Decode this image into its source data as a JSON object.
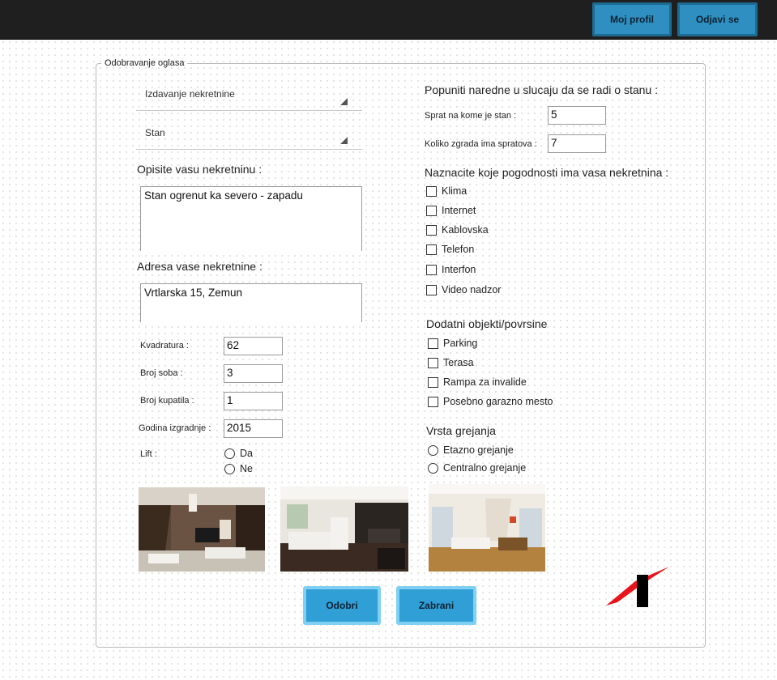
{
  "header": {
    "profile_label": "Moj profil",
    "logout_label": "Odjavi se"
  },
  "form": {
    "legend": "Odobravanje oglasa",
    "type_select": "Izdavanje nekretnine",
    "kind_select": "Stan",
    "description_label": "Opisite vasu nekretninu :",
    "description_value": "Stan ogrenut ka severo - zapadu",
    "address_label": "Adresa vase nekretnine :",
    "address_value": "Vrtlarska 15, Zemun",
    "fields": [
      {
        "label": "Kvadratura :",
        "value": "62"
      },
      {
        "label": "Broj soba :",
        "value": "3"
      },
      {
        "label": "Broj kupatila :",
        "value": "1"
      },
      {
        "label": "Godina izgradnje :",
        "value": "2015"
      }
    ],
    "lift": {
      "label": "Lift :",
      "options": [
        "Da",
        "Ne"
      ]
    },
    "apartment_title": "Popuniti naredne u slucaju da se radi o stanu :",
    "floor_label": "Sprat na kome je stan :",
    "floor_value": "5",
    "floors_total_label": "Koliko zgrada ima spratova :",
    "floors_total_value": "7",
    "amenities_title": "Naznacite koje pogodnosti ima vasa nekretnina :",
    "amenities": [
      "Klima",
      "Internet",
      "Kablovska",
      "Telefon",
      "Interfon",
      "Video nadzor"
    ],
    "extras_title": "Dodatni objekti/povrsine",
    "extras": [
      "Parking",
      "Terasa",
      "Rampa za invalide",
      "Posebno garazno mesto"
    ],
    "heating_title": "Vrsta grejanja",
    "heating": [
      "Etazno grejanje",
      "Centralno grejanje"
    ],
    "photos": [
      "living-room-photo",
      "lounge-kitchen-photo",
      "dining-room-photo"
    ],
    "approve_label": "Odobri",
    "reject_label": "Zabrani"
  },
  "colors": {
    "button": "#2f9fd6",
    "topbar": "#1f1f1f",
    "logo_red": "#e8141c"
  }
}
